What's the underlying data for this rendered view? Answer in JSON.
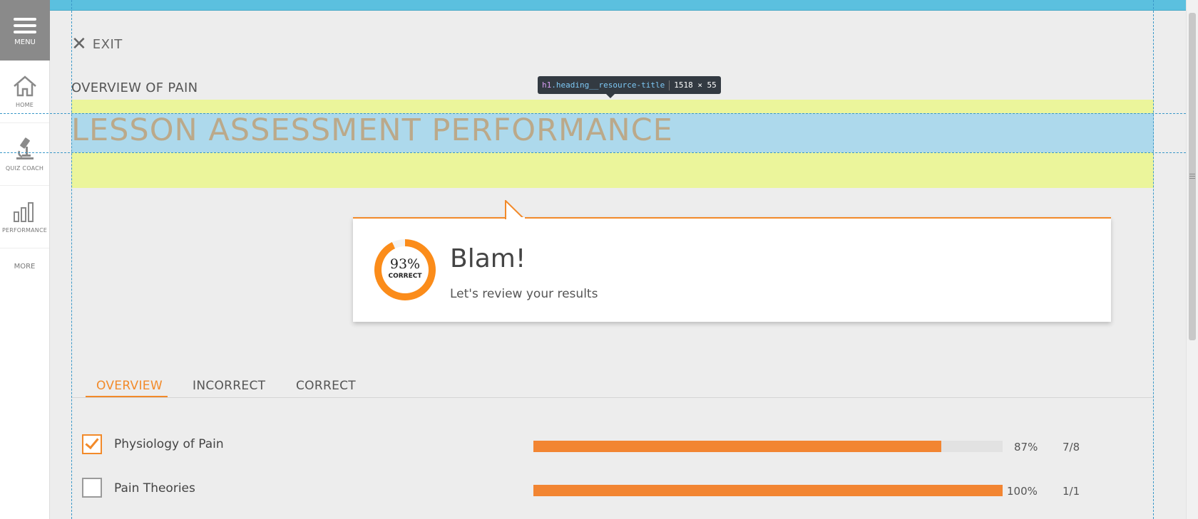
{
  "nav": {
    "menu_label": "MENU",
    "items": [
      {
        "label": "HOME",
        "icon": "home-icon"
      },
      {
        "label": "QUIZ COACH",
        "icon": "microscope-icon"
      },
      {
        "label": "PERFORMANCE",
        "icon": "bar-chart-icon"
      }
    ],
    "more_label": "MORE"
  },
  "exit_label": "EXIT",
  "page": {
    "subtitle": "OVERVIEW OF PAIN",
    "heading": "LESSON ASSESSMENT PERFORMANCE"
  },
  "inspector_tooltip": {
    "tag": "h1",
    "class_name": ".heading__resource-title",
    "size": "1518 × 55"
  },
  "result": {
    "percent_text": "93%",
    "percent_value": 93,
    "percent_label": "CORRECT",
    "title": "Blam!",
    "subtitle": "Let's review your results"
  },
  "tabs": [
    {
      "label": "OVERVIEW",
      "active": true
    },
    {
      "label": "INCORRECT",
      "active": false
    },
    {
      "label": "CORRECT",
      "active": false
    }
  ],
  "topics": [
    {
      "name": "Physiology of Pain",
      "checked": true,
      "percent": 87,
      "percent_text": "87%",
      "score": "7/8"
    },
    {
      "name": "Pain Theories",
      "checked": false,
      "percent": 100,
      "percent_text": "100%",
      "score": "1/1"
    }
  ],
  "colors": {
    "accent": "#f28a2a",
    "topbar": "#5bc0df",
    "highlight_margin": "#ebf59b",
    "highlight_content": "#add9ec"
  }
}
